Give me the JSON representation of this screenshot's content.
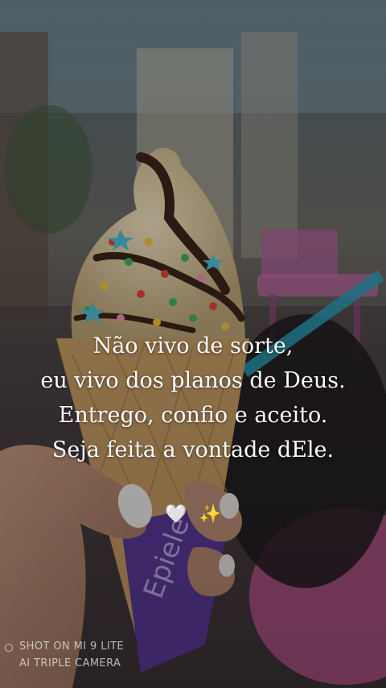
{
  "quote": {
    "lines": [
      "Não vivo de sorte,",
      "eu vivo dos planos de Deus.",
      "Entrego, confio e aceito.",
      "Seja feita a vontade dEle."
    ]
  },
  "emojis": {
    "heart": "🤍",
    "sparkles": "✨"
  },
  "watermark": {
    "line1": "SHOT ON MI 9 LITE",
    "line2": "AI TRIPLE CAMERA"
  },
  "colors": {
    "text": "#ffffff",
    "cone": "#d9b07a",
    "icecream": "#e8d9b5",
    "chocolate": "#3b2417",
    "wrapper": "#5b3a9a",
    "straw": "#2b9fb8",
    "chair": "#c86aa8"
  }
}
